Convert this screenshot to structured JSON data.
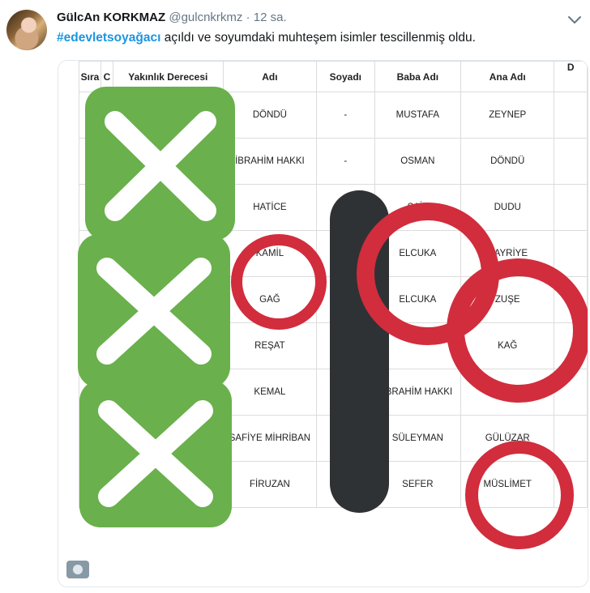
{
  "tweet": {
    "author_name": "GülcAn KORKMAZ",
    "handle": "@gulcnkrkmz",
    "separator": "·",
    "time": "12 sa.",
    "hashtag": "#edevletsoyağacı",
    "text": " açıldı ve soyumdaki muhteşem isimler tescillenmiş oldu."
  },
  "table": {
    "headers": {
      "sira": "Sıra",
      "c": "C",
      "yakinlik": "Yakınlık Derecesi",
      "adi": "Adı",
      "soyadi": "Soyadı",
      "baba": "Baba Adı",
      "ana": "Ana Adı",
      "d": "D"
    },
    "rows": [
      {
        "adi": "DÖNDÜ",
        "soyadi": "-",
        "baba": "MUSTAFA",
        "ana": "ZEYNEP"
      },
      {
        "adi": "İBRAHİM HAKKI",
        "soyadi": "-",
        "baba": "OSMAN",
        "ana": "DÖNDÜ"
      },
      {
        "adi": "HATİCE",
        "soyadi": "",
        "baba": "SAİT",
        "ana": "DUDU"
      },
      {
        "adi": "KAMİL",
        "soyadi": "",
        "baba": "ELCUKA",
        "ana": "HAYRİYE"
      },
      {
        "adi": "GAĞ",
        "soyadi": "",
        "baba": "ELCUKA",
        "ana": "ZUŞE"
      },
      {
        "adi": "REŞAT",
        "soyadi": "",
        "baba": "",
        "ana": "KAĞ"
      },
      {
        "adi": "KEMAL",
        "soyadi": "",
        "baba": "İBRAHİM HAKKI",
        "ana": ""
      },
      {
        "adi": "SAFİYE MİHRİBAN",
        "soyadi": "",
        "baba": "SÜLEYMAN",
        "ana": "GÜLÜZAR"
      },
      {
        "adi": "FİRUZAN",
        "soyadi": "",
        "baba": "SEFER",
        "ana": "MÜSLİMET"
      }
    ]
  },
  "overlay_colors": {
    "green": "#6ab04c",
    "red": "#d12d3d",
    "dark_bar": "#2e3235"
  },
  "icons": {
    "more": "chevron-down-icon",
    "media": "gif-badge-icon"
  }
}
